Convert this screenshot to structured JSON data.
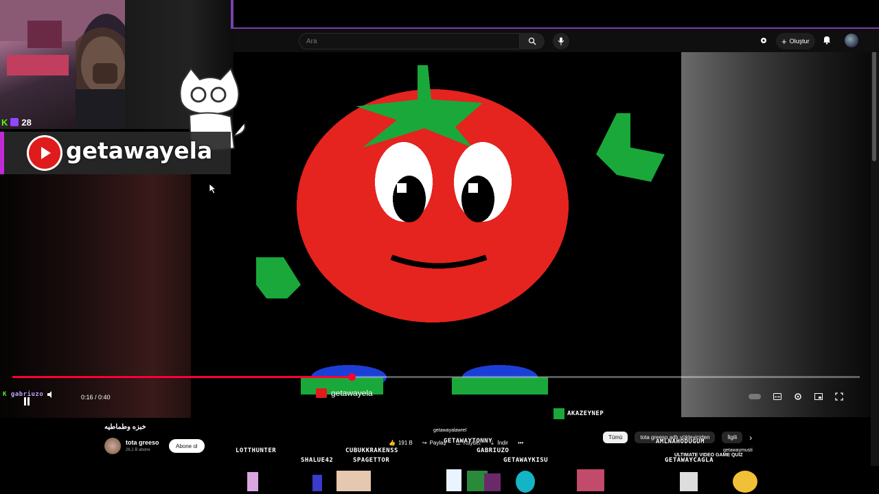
{
  "topbar": {
    "search_placeholder": "Ara",
    "create_label": "Oluştur"
  },
  "stream_overlay": {
    "viewer_count": "28",
    "channel_banner": "getawayela",
    "chat_user": "gabriuzo"
  },
  "player": {
    "time": "0:16 / 0:40",
    "progress": 0.4,
    "video_watermark": "getawayela"
  },
  "video_info": {
    "title": "خبزه وطماطيه",
    "channel_name": "tota greeso",
    "subscribers": "26,1 B abone",
    "subscribe_label": "Abone ol",
    "likes": "191 B",
    "share_label": "Paylaş",
    "save_label": "Kaydet",
    "download_label": "İndir"
  },
  "chips": [
    "Tümü",
    "tota greeso adlı yükleyiciden",
    "İlgili"
  ],
  "overlay_names": {
    "akazeynep": "AKAZEYNEP",
    "lotthunter": "LOTTHUNTER",
    "cubukkraken": "CUBUKKRAKENSS",
    "shalue": "SHALUE42",
    "spagettor": "SPAGETTOR",
    "getawaytonny": "GETAWAYTONNY",
    "gabriuzo_caps": "GABRIUZO",
    "getawaykisu": "GETAWAYKISU",
    "amlnahoduğum": "AMLNAHODUĞUM",
    "getawaycagla": "GETAWAYCAGLA",
    "getawayalawrel": "getawayalawrel",
    "getawaymusti": "getawaymusti",
    "quiz_title": "ULTIMATE VIDEO GAME QUIZ"
  },
  "colors": {
    "accent_purple": "#7a3fb0",
    "youtube_red": "#ff0033",
    "tomato_red": "#e5231f",
    "leaf_green": "#1aa83a"
  }
}
